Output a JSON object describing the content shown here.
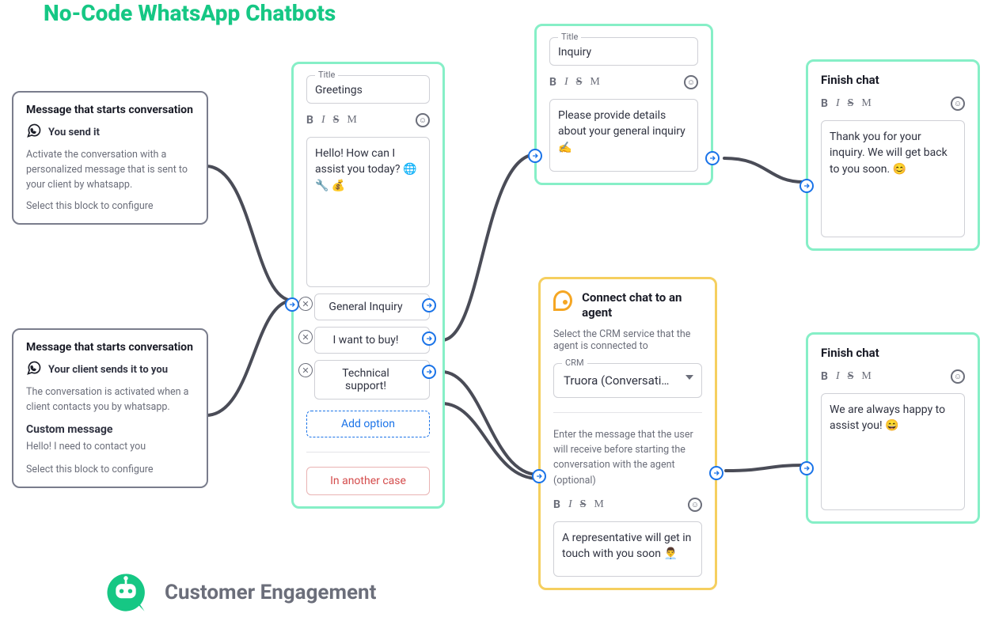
{
  "title": "No-Code WhatsApp Chatbots",
  "brand_footer": "Customer Engagement",
  "start_you": {
    "heading": "Message that starts conversation",
    "sub": "You send it",
    "desc": "Activate the conversation with a personalized message that is sent to your client by whatsapp.",
    "hint": "Select this block to configure"
  },
  "start_client": {
    "heading": "Message that starts conversation",
    "sub": "Your client sends it to you",
    "desc": "The conversation is activated when a client contacts you by whatsapp.",
    "custom_label": "Custom message",
    "custom_value": "Hello! I need to contact you",
    "hint": "Select this block to configure"
  },
  "greetings": {
    "title_label": "Title",
    "title_value": "Greetings",
    "format": {
      "b": "B",
      "i": "I",
      "s": "S",
      "m": "M"
    },
    "body": "Hello! How can I assist you today? 🌐 🔧 💰",
    "options": [
      "General Inquiry",
      "I want to buy!",
      "Technical support!"
    ],
    "add_option": "Add option",
    "alt_case": "In another case"
  },
  "inquiry": {
    "title_label": "Title",
    "title_value": "Inquiry",
    "body": "Please provide details about your general inquiry ✍️"
  },
  "agent": {
    "heading": "Connect chat to an agent",
    "desc": "Select the CRM service that the agent is connected to",
    "crm_label": "CRM",
    "crm_value": "Truora (Conversati…",
    "msg_hint": "Enter the message that the user will receive before starting the conversation with the agent (optional)",
    "body": "A representative will get in touch with you soon 👨‍💼"
  },
  "finish1": {
    "heading": "Finish chat",
    "body": "Thank you for your inquiry. We will get back to you soon. 😊"
  },
  "finish2": {
    "heading": "Finish chat",
    "body": "We are always happy to assist you! 😄"
  }
}
